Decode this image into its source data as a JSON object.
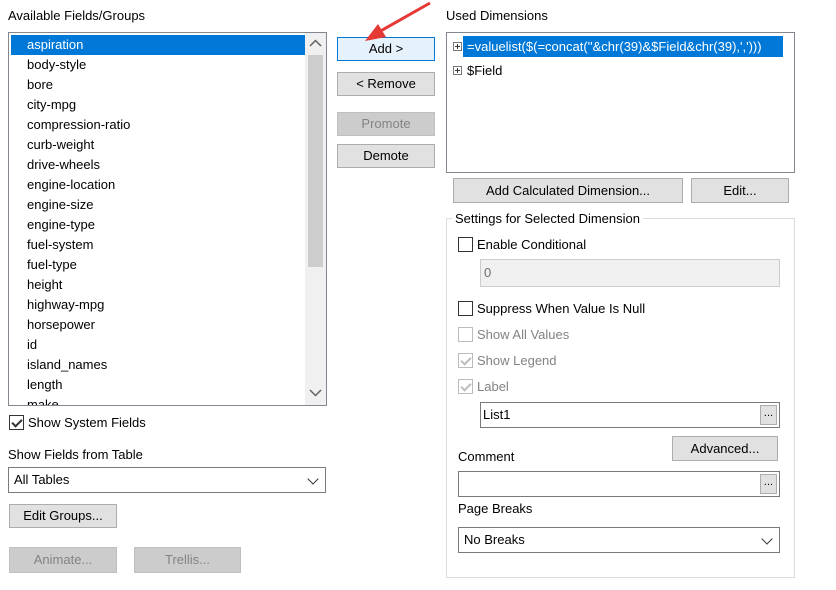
{
  "available": {
    "title": "Available Fields/Groups",
    "items": [
      "aspiration",
      "body-style",
      "bore",
      "city-mpg",
      "compression-ratio",
      "curb-weight",
      "drive-wheels",
      "engine-location",
      "engine-size",
      "engine-type",
      "fuel-system",
      "fuel-type",
      "height",
      "highway-mpg",
      "horsepower",
      "id",
      "island_names",
      "length",
      "make"
    ],
    "selected_index": 0,
    "show_system_fields": "Show System Fields",
    "show_fields_from_table": "Show Fields from Table",
    "table_select": "All Tables",
    "edit_groups": "Edit Groups...",
    "animate": "Animate...",
    "trellis": "Trellis..."
  },
  "actions": {
    "add": "Add >",
    "remove": "< Remove",
    "promote": "Promote",
    "demote": "Demote"
  },
  "used": {
    "title": "Used Dimensions",
    "items": [
      "=valuelist($(=concat(''&chr(39)&$Field&chr(39),',')))",
      "$Field"
    ],
    "add_calculated": "Add Calculated Dimension...",
    "edit": "Edit..."
  },
  "settings": {
    "title": "Settings for Selected Dimension",
    "enable_conditional": "Enable Conditional",
    "conditional_value": "0",
    "suppress_null": "Suppress When Value Is Null",
    "show_all_values": "Show All Values",
    "show_legend": "Show Legend",
    "label": "Label",
    "label_value": "List1",
    "advanced": "Advanced...",
    "comment": "Comment",
    "page_breaks": "Page Breaks",
    "page_breaks_value": "No Breaks",
    "ellipsis": "..."
  },
  "colors": {
    "selection": "#0078d7",
    "arrow": "#e53935"
  }
}
